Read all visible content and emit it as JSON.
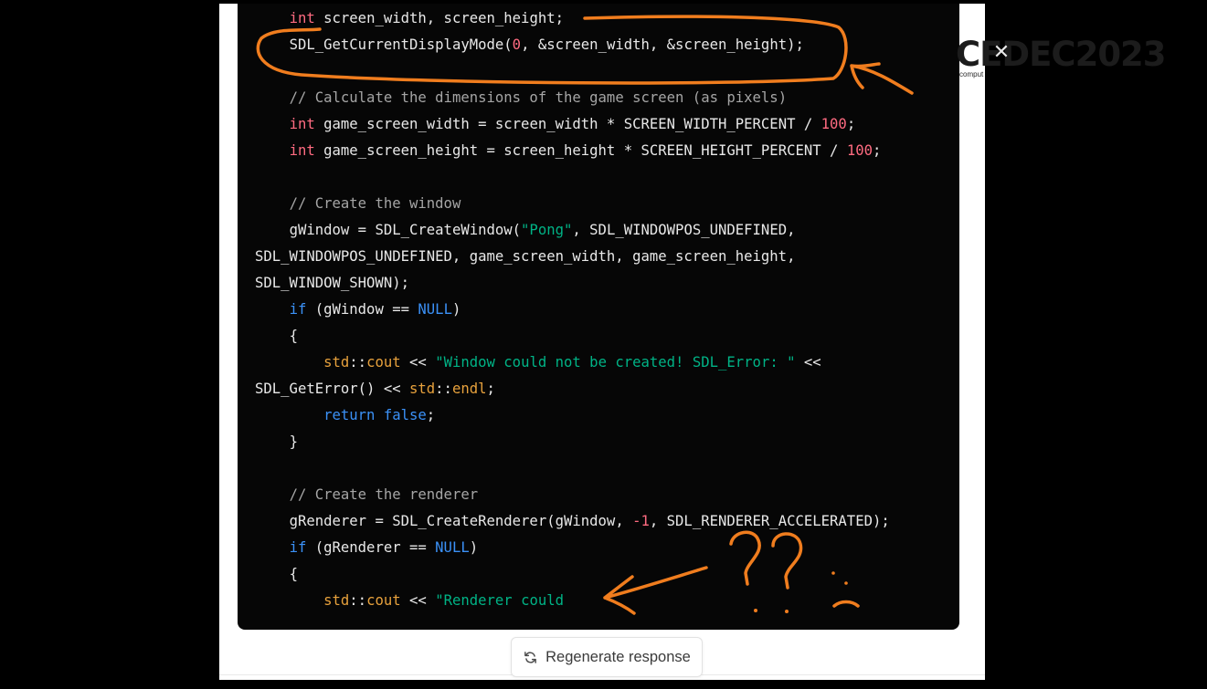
{
  "code_lines": [
    {
      "indent": "    ",
      "tokens": [
        {
          "t": "int",
          "c": "tok-kw"
        },
        {
          "t": " screen_width, screen_height;",
          "c": ""
        }
      ]
    },
    {
      "indent": "    ",
      "tokens": [
        {
          "t": "SDL_GetCurrentDisplayMode(",
          "c": ""
        },
        {
          "t": "0",
          "c": "tok-num"
        },
        {
          "t": ", &screen_width, &screen_height);",
          "c": ""
        }
      ]
    },
    {
      "indent": "",
      "tokens": []
    },
    {
      "indent": "    ",
      "tokens": [
        {
          "t": "// Calculate the dimensions of the game screen (as pixels)",
          "c": "tok-cmt"
        }
      ]
    },
    {
      "indent": "    ",
      "tokens": [
        {
          "t": "int",
          "c": "tok-kw"
        },
        {
          "t": " game_screen_width = screen_width * SCREEN_WIDTH_PERCENT / ",
          "c": ""
        },
        {
          "t": "100",
          "c": "tok-num"
        },
        {
          "t": ";",
          "c": ""
        }
      ]
    },
    {
      "indent": "    ",
      "tokens": [
        {
          "t": "int",
          "c": "tok-kw"
        },
        {
          "t": " game_screen_height = screen_height * SCREEN_HEIGHT_PERCENT / ",
          "c": ""
        },
        {
          "t": "100",
          "c": "tok-num"
        },
        {
          "t": ";",
          "c": ""
        }
      ]
    },
    {
      "indent": "",
      "tokens": []
    },
    {
      "indent": "    ",
      "tokens": [
        {
          "t": "// Create the window",
          "c": "tok-cmt"
        }
      ]
    },
    {
      "indent": "    ",
      "tokens": [
        {
          "t": "gWindow = SDL_CreateWindow(",
          "c": ""
        },
        {
          "t": "\"Pong\"",
          "c": "tok-str"
        },
        {
          "t": ", SDL_WINDOWPOS_UNDEFINED,",
          "c": ""
        }
      ]
    },
    {
      "indent": "",
      "tokens": [
        {
          "t": "SDL_WINDOWPOS_UNDEFINED, game_screen_width, game_screen_height,",
          "c": ""
        }
      ]
    },
    {
      "indent": "",
      "tokens": [
        {
          "t": "SDL_WINDOW_SHOWN);",
          "c": ""
        }
      ]
    },
    {
      "indent": "    ",
      "tokens": [
        {
          "t": "if",
          "c": "tok-blue"
        },
        {
          "t": " (gWindow == ",
          "c": ""
        },
        {
          "t": "NULL",
          "c": "tok-blue"
        },
        {
          "t": ")",
          "c": ""
        }
      ]
    },
    {
      "indent": "    ",
      "tokens": [
        {
          "t": "{",
          "c": ""
        }
      ]
    },
    {
      "indent": "        ",
      "tokens": [
        {
          "t": "std",
          "c": "tok-std"
        },
        {
          "t": "::",
          "c": ""
        },
        {
          "t": "cout",
          "c": "tok-std"
        },
        {
          "t": " << ",
          "c": ""
        },
        {
          "t": "\"Window could not be created! SDL_Error: \"",
          "c": "tok-str"
        },
        {
          "t": " <<",
          "c": ""
        }
      ]
    },
    {
      "indent": "",
      "tokens": [
        {
          "t": "SDL_GetError() << ",
          "c": ""
        },
        {
          "t": "std",
          "c": "tok-std"
        },
        {
          "t": "::",
          "c": ""
        },
        {
          "t": "endl",
          "c": "tok-std"
        },
        {
          "t": ";",
          "c": ""
        }
      ]
    },
    {
      "indent": "        ",
      "tokens": [
        {
          "t": "return",
          "c": "tok-blue"
        },
        {
          "t": " ",
          "c": ""
        },
        {
          "t": "false",
          "c": "tok-blue"
        },
        {
          "t": ";",
          "c": ""
        }
      ]
    },
    {
      "indent": "    ",
      "tokens": [
        {
          "t": "}",
          "c": ""
        }
      ]
    },
    {
      "indent": "",
      "tokens": []
    },
    {
      "indent": "    ",
      "tokens": [
        {
          "t": "// Create the renderer",
          "c": "tok-cmt"
        }
      ]
    },
    {
      "indent": "    ",
      "tokens": [
        {
          "t": "gRenderer = SDL_CreateRenderer(gWindow, ",
          "c": ""
        },
        {
          "t": "-1",
          "c": "tok-num"
        },
        {
          "t": ", SDL_RENDERER_ACCELERATED);",
          "c": ""
        }
      ]
    },
    {
      "indent": "    ",
      "tokens": [
        {
          "t": "if",
          "c": "tok-blue"
        },
        {
          "t": " (gRenderer == ",
          "c": ""
        },
        {
          "t": "NULL",
          "c": "tok-blue"
        },
        {
          "t": ")",
          "c": ""
        }
      ]
    },
    {
      "indent": "    ",
      "tokens": [
        {
          "t": "{",
          "c": ""
        }
      ]
    },
    {
      "indent": "        ",
      "tokens": [
        {
          "t": "std",
          "c": "tok-std"
        },
        {
          "t": "::",
          "c": ""
        },
        {
          "t": "cout",
          "c": "tok-std"
        },
        {
          "t": " << ",
          "c": ""
        },
        {
          "t": "\"Renderer could",
          "c": "tok-str"
        }
      ]
    }
  ],
  "regenerate": {
    "label": "Regenerate response",
    "icon": "refresh-icon"
  },
  "event_logo": {
    "text": "CEDEC2023",
    "sub": "comput"
  },
  "annotations": {
    "color": "#f07d1e",
    "marks": [
      "ellipse-highlight",
      "arrow-to-ellipse",
      "arrow-to-renderer",
      "question-marks",
      "sad-face"
    ]
  },
  "colors": {
    "background": "#000000",
    "code_bg": "#060606",
    "panel_bg": "#ffffff"
  }
}
